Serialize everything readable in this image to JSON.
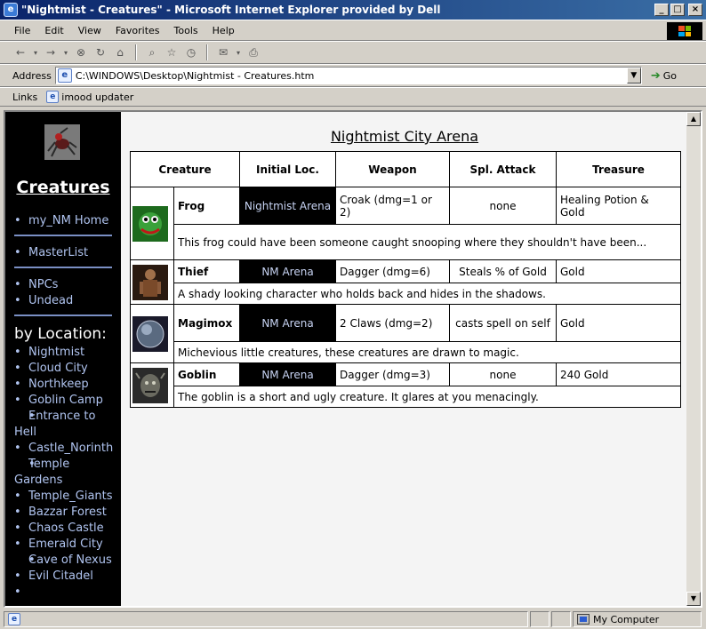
{
  "window": {
    "title": "\"Nightmist - Creatures\" - Microsoft Internet Explorer provided by Dell",
    "icon": "ie-icon",
    "min": "_",
    "max": "□",
    "close": "×"
  },
  "menu": [
    "File",
    "Edit",
    "View",
    "Favorites",
    "Tools",
    "Help"
  ],
  "address": {
    "label": "Address",
    "value": "C:\\WINDOWS\\Desktop\\Nightmist - Creatures.htm",
    "go_label": "Go"
  },
  "links": {
    "label": "Links",
    "items": [
      "imood updater"
    ]
  },
  "sidebar": {
    "title": "Creatures",
    "group1": [
      "my_NM Home"
    ],
    "group2": [
      "MasterList"
    ],
    "group3": [
      "NPCs",
      "Undead"
    ],
    "location_heading": "by Location:",
    "locations": [
      "Nightmist",
      "Cloud City",
      "Northkeep",
      "Goblin Camp",
      "Entrance to Hell",
      "Castle_Norinth",
      "Temple Gardens",
      "Temple_Giants",
      "Bazzar Forest",
      "Chaos Castle",
      "Emerald City",
      "Cave of Nexus",
      "Evil Citadel",
      ""
    ]
  },
  "arena_title": "Nightmist City Arena",
  "table": {
    "headers": [
      "Creature",
      "Initial Loc.",
      "Weapon",
      "Spl. Attack",
      "Treasure"
    ],
    "rows": [
      {
        "name": "Frog",
        "loc": "Nightmist Arena",
        "weapon": "Croak (dmg=1 or 2)",
        "attack": "none",
        "treasure": "Healing Potion & Gold",
        "desc": "This frog could have been someone caught snooping where they shouldn't have been...",
        "icon": "frog-portrait"
      },
      {
        "name": "Thief",
        "loc": "NM Arena",
        "weapon": "Dagger (dmg=6)",
        "attack": "Steals % of Gold",
        "treasure": "Gold",
        "desc": "A shady looking character who holds back and hides in the shadows.",
        "icon": "thief-portrait"
      },
      {
        "name": "Magimox",
        "loc": "NM Arena",
        "weapon": "2 Claws (dmg=2)",
        "attack": "casts spell on self",
        "treasure": "Gold",
        "desc": "Michevious little creatures, these creatures are drawn to magic.",
        "icon": "magimox-portrait"
      },
      {
        "name": "Goblin",
        "loc": "NM Arena",
        "weapon": "Dagger (dmg=3)",
        "attack": "none",
        "treasure": "240 Gold",
        "desc": "The goblin is a short and ugly creature. It glares at you menacingly.",
        "icon": "goblin-portrait"
      }
    ]
  },
  "status": {
    "zone": "My Computer"
  }
}
